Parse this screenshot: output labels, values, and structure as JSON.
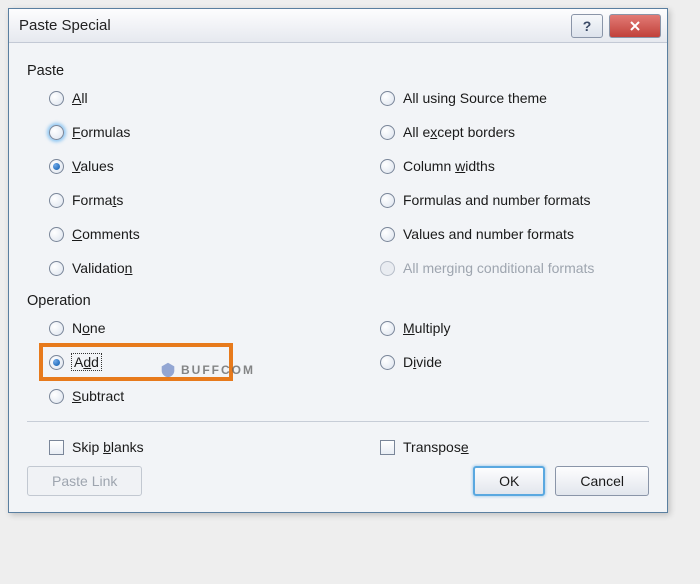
{
  "title": "Paste Special",
  "groups": {
    "paste": {
      "label": "Paste",
      "left": [
        {
          "id": "all",
          "label": "All",
          "underline": "A",
          "selected": false,
          "hover": false
        },
        {
          "id": "formulas",
          "label": "Formulas",
          "underline": "F",
          "selected": false,
          "hover": true
        },
        {
          "id": "values",
          "label": "Values",
          "underline": "V",
          "selected": true,
          "hover": false
        },
        {
          "id": "formats",
          "label": "Formats",
          "underline": "T",
          "selected": false,
          "hover": false
        },
        {
          "id": "comments",
          "label": "Comments",
          "underline": "C",
          "selected": false,
          "hover": false
        },
        {
          "id": "validation",
          "label": "Validation",
          "underline": "N",
          "selected": false,
          "hover": false
        }
      ],
      "right": [
        {
          "id": "all-theme",
          "label": "All using Source theme",
          "underline": null,
          "selected": false,
          "hover": false,
          "disabled": false
        },
        {
          "id": "except-borders",
          "label": "All except borders",
          "underline": "x",
          "selected": false,
          "hover": false
        },
        {
          "id": "col-widths",
          "label": "Column widths",
          "underline": "W",
          "selected": false,
          "hover": false
        },
        {
          "id": "formulas-nf",
          "label": "Formulas and number formats",
          "underline": null,
          "selected": false,
          "hover": false
        },
        {
          "id": "values-nf",
          "label": "Values and number formats",
          "underline": null,
          "selected": false,
          "hover": false
        },
        {
          "id": "merge-cond",
          "label": "All merging conditional formats",
          "underline": null,
          "selected": false,
          "hover": false,
          "disabled": true
        }
      ]
    },
    "operation": {
      "label": "Operation",
      "left": [
        {
          "id": "none",
          "label": "None",
          "underline": "O",
          "selected": false
        },
        {
          "id": "add",
          "label": "Add",
          "underline": "D",
          "selected": true,
          "highlight": true
        },
        {
          "id": "subtract",
          "label": "Subtract",
          "underline": "S",
          "selected": false
        }
      ],
      "right": [
        {
          "id": "multiply",
          "label": "Multiply",
          "underline": "M",
          "selected": false
        },
        {
          "id": "divide",
          "label": "Divide",
          "underline": "I",
          "selected": false
        }
      ]
    }
  },
  "checks": {
    "skip_blanks": {
      "label": "Skip blanks",
      "underline": "B",
      "checked": false
    },
    "transpose": {
      "label": "Transpose",
      "underline": "E",
      "checked": false
    }
  },
  "buttons": {
    "paste_link": {
      "label": "Paste Link",
      "disabled": true
    },
    "ok": {
      "label": "OK",
      "default": true
    },
    "cancel": {
      "label": "Cancel"
    }
  },
  "watermark": {
    "text": "BUFFCOM"
  }
}
